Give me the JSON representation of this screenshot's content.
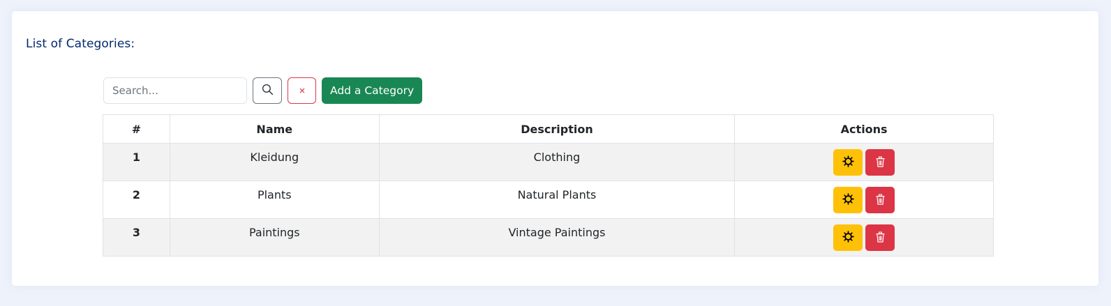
{
  "page": {
    "title": "List of Categories:"
  },
  "toolbar": {
    "search_placeholder": "Search...",
    "search_value": "",
    "search_icon": "search-icon",
    "clear_label": "×",
    "add_label": "Add a Category"
  },
  "table": {
    "headers": [
      "#",
      "Name",
      "Description",
      "Actions"
    ],
    "rows": [
      {
        "index": "1",
        "name": "Kleidung",
        "description": "Clothing"
      },
      {
        "index": "2",
        "name": "Plants",
        "description": "Natural Plants"
      },
      {
        "index": "3",
        "name": "Paintings",
        "description": "Vintage Paintings"
      }
    ],
    "edit_icon": "gear-icon",
    "delete_icon": "trash-icon"
  },
  "colors": {
    "title": "#012970",
    "add_button": "#198754",
    "edit_button": "#ffc107",
    "delete_button": "#dc3545",
    "clear_border": "#dc3545",
    "page_background": "#eef2fb"
  }
}
